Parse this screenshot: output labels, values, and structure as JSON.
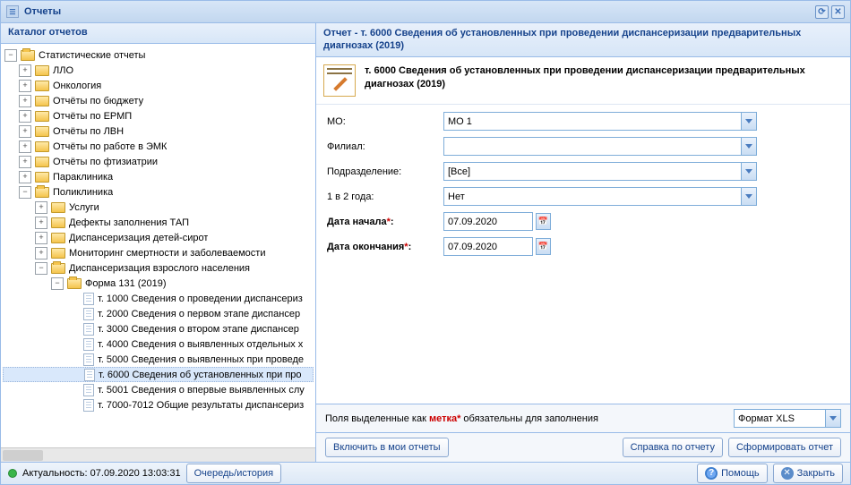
{
  "window": {
    "title": "Отчеты"
  },
  "catalog": {
    "title": "Каталог отчетов"
  },
  "tree": {
    "root": "Статистические отчеты",
    "items": [
      "ЛЛО",
      "Онкология",
      "Отчёты по бюджету",
      "Отчёты по ЕРМП",
      "Отчёты по ЛВН",
      "Отчёты по работе в ЭМК",
      "Отчёты по фтизиатрии",
      "Параклиника"
    ],
    "open1": "Поликлиника",
    "sub1": [
      "Услуги",
      "Дефекты заполнения ТАП",
      "Диспансеризация детей-сирот",
      "Мониторинг смертности и заболеваемости"
    ],
    "open2": "Диспансеризация взрослого населения",
    "open3": "Форма 131 (2019)",
    "leaves": [
      "т. 1000 Сведения о проведении диспансериз",
      "т. 2000 Сведения о первом этапе диспансер",
      "т. 3000 Сведения о втором этапе диспансер",
      "т. 4000 Сведения о выявленных отдельных х",
      "т. 5000 Сведения о выявленных при проведе",
      "т. 6000 Сведения об установленных при про",
      "т. 5001 Сведения о впервые выявленных слу",
      "т. 7000-7012 Общие результаты диспансериз"
    ],
    "selectedIndex": 5
  },
  "report": {
    "panel_title": "Отчет - т. 6000 Сведения об установленных при проведении диспансеризации предварительных диагнозах (2019)",
    "title": "т. 6000 Сведения об установленных при проведении диспансеризации предварительных диагнозах (2019)"
  },
  "form": {
    "mo": {
      "label": "МО:",
      "value": "МО 1"
    },
    "filial": {
      "label": "Филиал:",
      "value": ""
    },
    "dept": {
      "label": "Подразделение:",
      "value": "[Все]"
    },
    "freq": {
      "label": "1 в 2 года:",
      "value": "Нет"
    },
    "date_start": {
      "label": "Дата начала",
      "value": "07.09.2020"
    },
    "date_end": {
      "label": "Дата окончания",
      "value": "07.09.2020"
    }
  },
  "meta": {
    "hint_pre": "Поля выделенные как ",
    "hint_mark": "метка*",
    "hint_post": " обязательны для заполнения",
    "format": "Формат XLS"
  },
  "buttons": {
    "include": "Включить в мои отчеты",
    "help_report": "Справка по отчету",
    "generate": "Сформировать отчет",
    "queue": "Очередь/история",
    "help": "Помощь",
    "close": "Закрыть"
  },
  "status": {
    "text": "Актуальность: 07.09.2020 13:03:31"
  }
}
